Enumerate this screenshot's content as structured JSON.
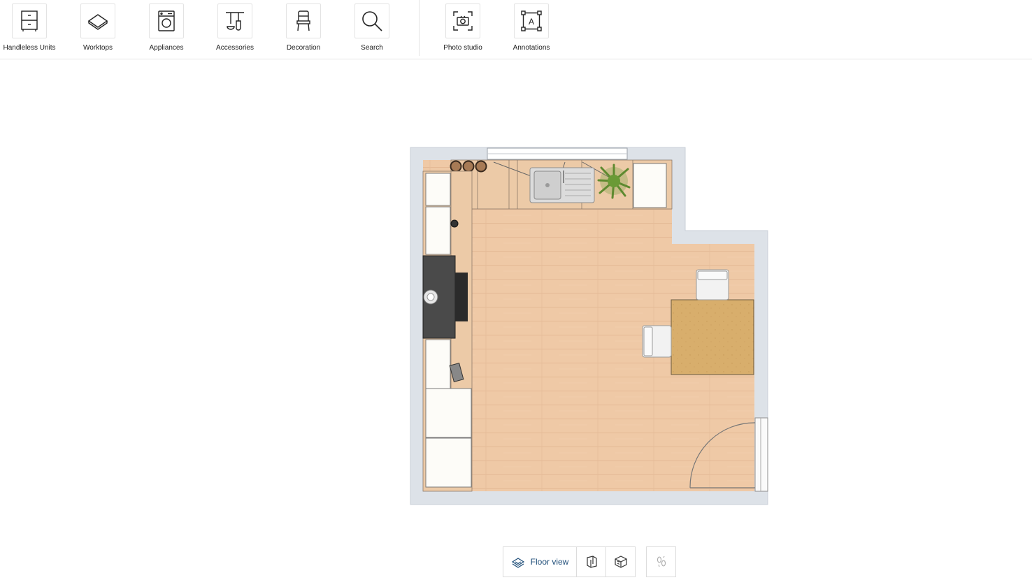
{
  "toolbar": {
    "items": [
      {
        "label": "Handleless Units",
        "icon": "cabinet-icon"
      },
      {
        "label": "Worktops",
        "icon": "worktop-icon"
      },
      {
        "label": "Appliances",
        "icon": "washing-machine-icon"
      },
      {
        "label": "Accessories",
        "icon": "utensils-icon"
      },
      {
        "label": "Decoration",
        "icon": "chair-icon"
      },
      {
        "label": "Search",
        "icon": "search-icon"
      },
      {
        "label": "Photo studio",
        "icon": "camera-icon"
      },
      {
        "label": "Annotations",
        "icon": "annotation-icon"
      }
    ]
  },
  "view_controls": {
    "floor_view_label": "Floor view"
  },
  "colors": {
    "wall": "#dde2e8",
    "floor": "#efc9a6",
    "cabinet": "#fdfcf8",
    "table": "#d7ad6a",
    "accent": "#1f4e79"
  }
}
